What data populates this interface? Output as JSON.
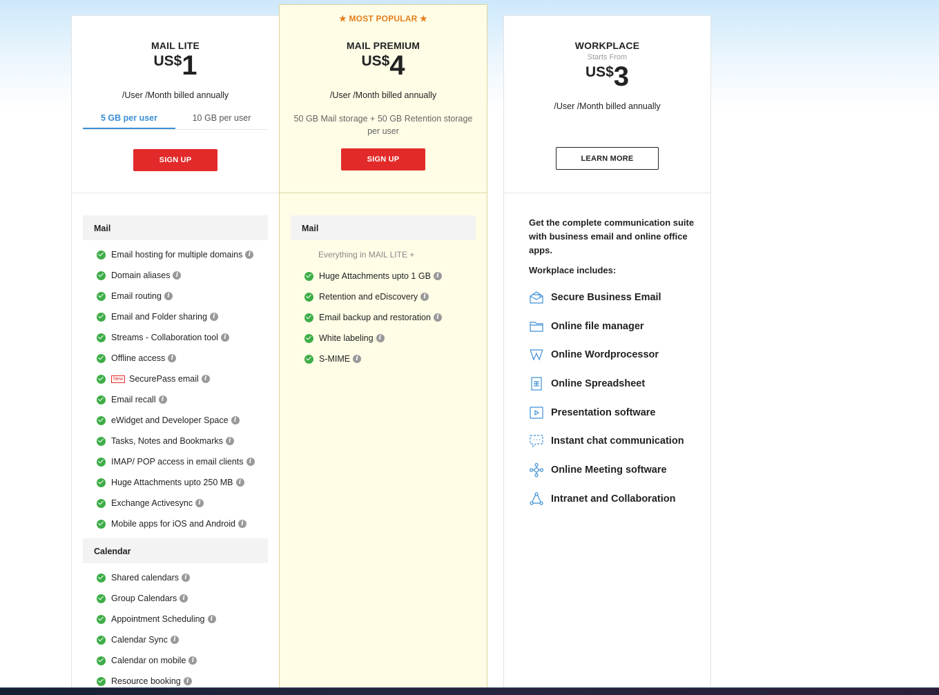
{
  "lite": {
    "name": "MAIL LITE",
    "currency": "US$",
    "price": "1",
    "billing": "/User /Month billed annually",
    "tabs": [
      "5 GB per user",
      "10 GB per user"
    ],
    "cta": "SIGN UP",
    "sections": [
      {
        "title": "Mail",
        "features": [
          {
            "label": "Email hosting for multiple domains"
          },
          {
            "label": "Domain aliases"
          },
          {
            "label": "Email routing"
          },
          {
            "label": "Email and Folder sharing"
          },
          {
            "label": "Streams - Collaboration tool"
          },
          {
            "label": "Offline access"
          },
          {
            "label": "SecurePass email",
            "badge": "New"
          },
          {
            "label": "Email recall"
          },
          {
            "label": "eWidget and Developer Space"
          },
          {
            "label": "Tasks, Notes and Bookmarks"
          },
          {
            "label": "IMAP/ POP access in email clients"
          },
          {
            "label": "Huge Attachments upto 250 MB"
          },
          {
            "label": "Exchange Activesync"
          },
          {
            "label": "Mobile apps for iOS and Android"
          }
        ]
      },
      {
        "title": "Calendar",
        "features": [
          {
            "label": "Shared calendars"
          },
          {
            "label": "Group Calendars"
          },
          {
            "label": "Appointment Scheduling"
          },
          {
            "label": "Calendar Sync"
          },
          {
            "label": "Calendar on mobile"
          },
          {
            "label": "Resource booking"
          }
        ]
      }
    ]
  },
  "premium": {
    "tag": "★ MOST POPULAR ★",
    "name": "MAIL PREMIUM",
    "currency": "US$",
    "price": "4",
    "billing": "/User /Month billed annually",
    "storage": "50 GB Mail storage + 50 GB Retention storage per user",
    "cta": "SIGN UP",
    "section_title": "Mail",
    "everything": "Everything in MAIL LITE +",
    "features": [
      {
        "label": "Huge Attachments upto 1 GB"
      },
      {
        "label": "Retention and eDiscovery"
      },
      {
        "label": "Email backup and restoration"
      },
      {
        "label": "White labeling"
      },
      {
        "label": "S-MIME"
      }
    ]
  },
  "workplace": {
    "name": "WORKPLACE",
    "starts_from": "Starts From",
    "currency": "US$",
    "price": "3",
    "billing": "/User /Month billed annually",
    "cta": "LEARN MORE",
    "intro": "Get the complete communication suite with business email and online office apps.",
    "includes_title": "Workplace includes:",
    "items": [
      {
        "label": "Secure Business Email",
        "icon": "mail-open-icon"
      },
      {
        "label": "Online file manager",
        "icon": "folder-icon"
      },
      {
        "label": "Online Wordprocessor",
        "icon": "writer-icon"
      },
      {
        "label": "Online Spreadsheet",
        "icon": "spreadsheet-icon"
      },
      {
        "label": "Presentation software",
        "icon": "presentation-icon"
      },
      {
        "label": "Instant chat communication",
        "icon": "chat-icon"
      },
      {
        "label": "Online Meeting software",
        "icon": "meeting-icon"
      },
      {
        "label": "Intranet and Collaboration",
        "icon": "collaboration-icon"
      }
    ]
  },
  "info_glyph": "i",
  "colors": {
    "accent_red": "#e32a2a",
    "popular_orange": "#e57f1c",
    "check_green": "#3eae48",
    "tab_blue": "#3b8fd6",
    "premium_bg": "#fffde6"
  }
}
